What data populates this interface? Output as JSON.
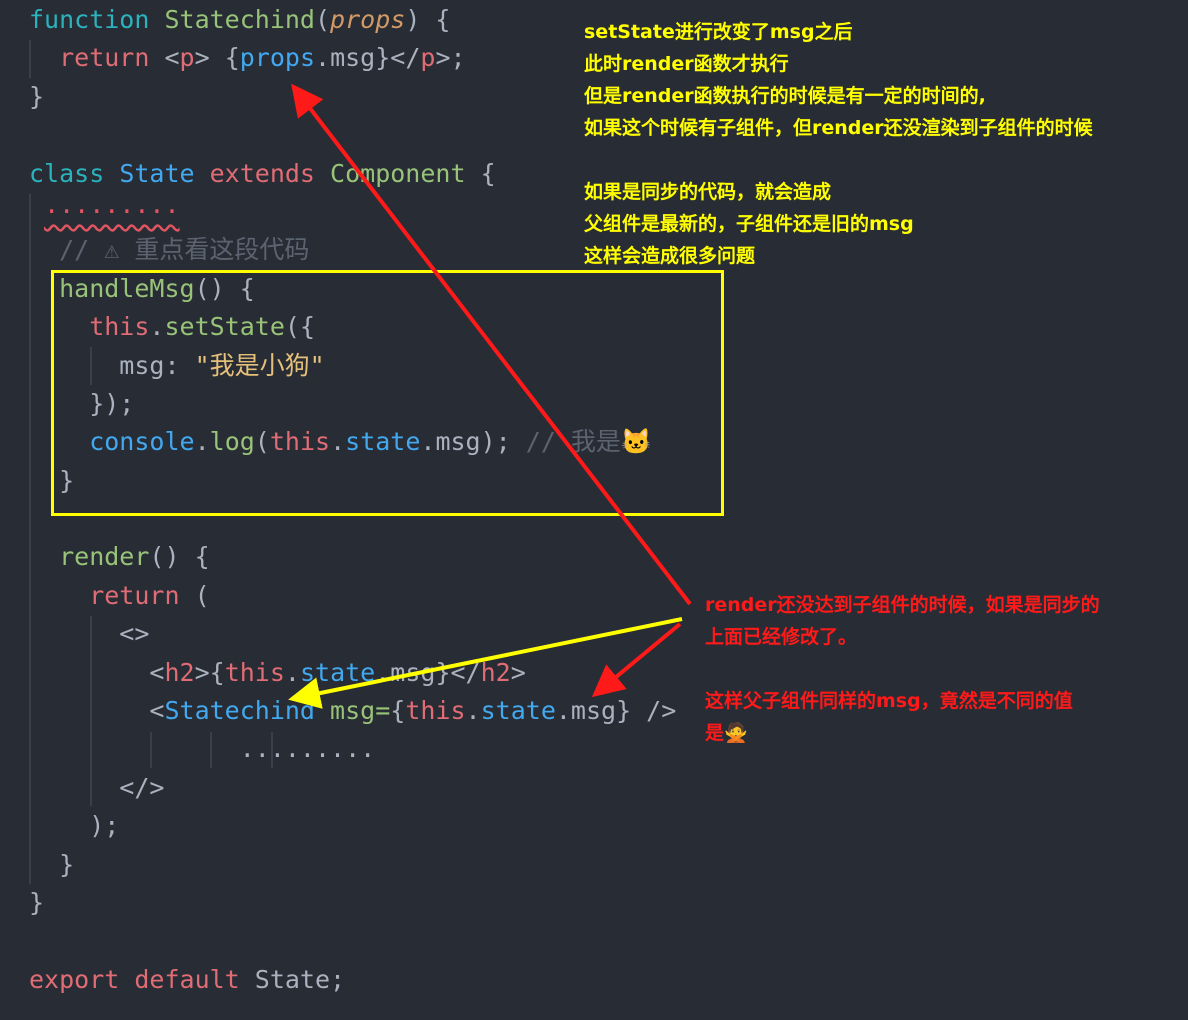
{
  "code_lines": [
    [
      [
        "function ",
        "kw"
      ],
      [
        "Statechind",
        "fn"
      ],
      [
        "(",
        "pu"
      ],
      [
        "props",
        "par"
      ],
      [
        ") {",
        "pu"
      ]
    ],
    [
      [
        "  return ",
        "rd"
      ],
      [
        "<",
        "pu"
      ],
      [
        "p",
        "rd"
      ],
      [
        "> {",
        "pu"
      ],
      [
        "props",
        "bl"
      ],
      [
        ".msg}</",
        "pu"
      ],
      [
        "p",
        "rd"
      ],
      [
        ">;",
        "pu"
      ]
    ],
    [
      [
        "}",
        "pu"
      ]
    ],
    [],
    [
      [
        "class ",
        "kw"
      ],
      [
        "State ",
        "bl"
      ],
      [
        "extends ",
        "rd"
      ],
      [
        "Component ",
        "fn"
      ],
      [
        "{",
        "pu"
      ]
    ],
    [
      [
        " ",
        ""
      ],
      [
        "·········",
        "sq"
      ]
    ],
    [
      [
        "  // ⚠ 重点看这段代码",
        "cm"
      ]
    ],
    [
      [
        "  handleMsg",
        "fn"
      ],
      [
        "() {",
        "pu"
      ]
    ],
    [
      [
        "    this",
        "rd"
      ],
      [
        ".",
        "pu"
      ],
      [
        "setState",
        "fn"
      ],
      [
        "({",
        "pu"
      ]
    ],
    [
      [
        "      msg: ",
        "pu"
      ],
      [
        "\"我是小狗\"",
        "st"
      ]
    ],
    [
      [
        "    });",
        "pu"
      ]
    ],
    [
      [
        "    console",
        "bl"
      ],
      [
        ".",
        "pu"
      ],
      [
        "log",
        "fn"
      ],
      [
        "(",
        "pu"
      ],
      [
        "this",
        "rd"
      ],
      [
        ".",
        "pu"
      ],
      [
        "state",
        "bl"
      ],
      [
        ".msg); ",
        "pu"
      ],
      [
        "// 我是🐱",
        "cm"
      ]
    ],
    [
      [
        "  }",
        "pu"
      ]
    ],
    [],
    [
      [
        "  render",
        "fn"
      ],
      [
        "() {",
        "pu"
      ]
    ],
    [
      [
        "    return ",
        "rd"
      ],
      [
        "(",
        "pu"
      ]
    ],
    [
      [
        "      <>",
        "pu"
      ]
    ],
    [
      [
        "        <",
        "pu"
      ],
      [
        "h2",
        "rd"
      ],
      [
        ">{",
        "pu"
      ],
      [
        "this",
        "rd"
      ],
      [
        ".",
        "pu"
      ],
      [
        "state",
        "bl"
      ],
      [
        ".msg}</",
        "pu"
      ],
      [
        "h2",
        "rd"
      ],
      [
        ">",
        "pu"
      ]
    ],
    [
      [
        "        <",
        "pu"
      ],
      [
        "Statechind ",
        "bl"
      ],
      [
        "msg=",
        "fn"
      ],
      [
        "{",
        "pu"
      ],
      [
        "this",
        "rd"
      ],
      [
        ".",
        "pu"
      ],
      [
        "state",
        "bl"
      ],
      [
        ".msg} />",
        "pu"
      ]
    ],
    [
      [
        "              .........",
        "pu"
      ]
    ],
    [
      [
        "      </>",
        "pu"
      ]
    ],
    [
      [
        "    );",
        "pu"
      ]
    ],
    [
      [
        "  }",
        "pu"
      ]
    ],
    [
      [
        "}",
        "pu"
      ]
    ],
    [],
    [
      [
        "export ",
        "rd"
      ],
      [
        "default ",
        "rd"
      ],
      [
        "State;",
        "pu"
      ]
    ]
  ],
  "annotations": {
    "yellow_note": "setState进行改变了msg之后\n此时render函数才执行\n但是render函数执行的时候是有一定的时间的,\n如果这个时候有子组件，但render还没渲染到子组件的时候\n\n如果是同步的代码，就会造成\n父组件是最新的，子组件还是旧的msg\n这样会造成很多问题",
    "red_note": "render还没达到子组件的时候，如果是同步的\n上面已经修改了。\n\n这样父子组件同样的msg，竟然是不同的值\n是🙅",
    "colors": {
      "box": "#ffff00",
      "red_arrow": "#ff1a1a",
      "yellow_arrow": "#ffff00",
      "background": "#282c34"
    }
  }
}
